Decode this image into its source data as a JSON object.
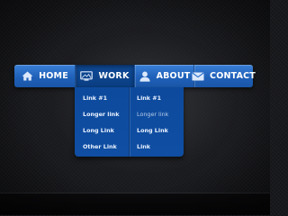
{
  "nav": {
    "items": [
      {
        "label": "HOME",
        "icon": "home-icon"
      },
      {
        "label": "WORK",
        "icon": "monitor-icon",
        "active": true
      },
      {
        "label": "ABOUT",
        "icon": "user-icon"
      },
      {
        "label": "CONTACT",
        "icon": "envelope-icon"
      }
    ]
  },
  "dropdown": {
    "left_column": [
      "Link #1",
      "Longer link",
      "Long Link",
      "Other Link"
    ],
    "right_column": [
      "Link #1",
      "Longer link",
      "Long Link",
      "Link"
    ]
  },
  "colors": {
    "bar_blue": "#2a6fcb",
    "active_blue": "#0c4389",
    "dropdown_blue": "#0e4ca0",
    "background": "#18191c"
  }
}
